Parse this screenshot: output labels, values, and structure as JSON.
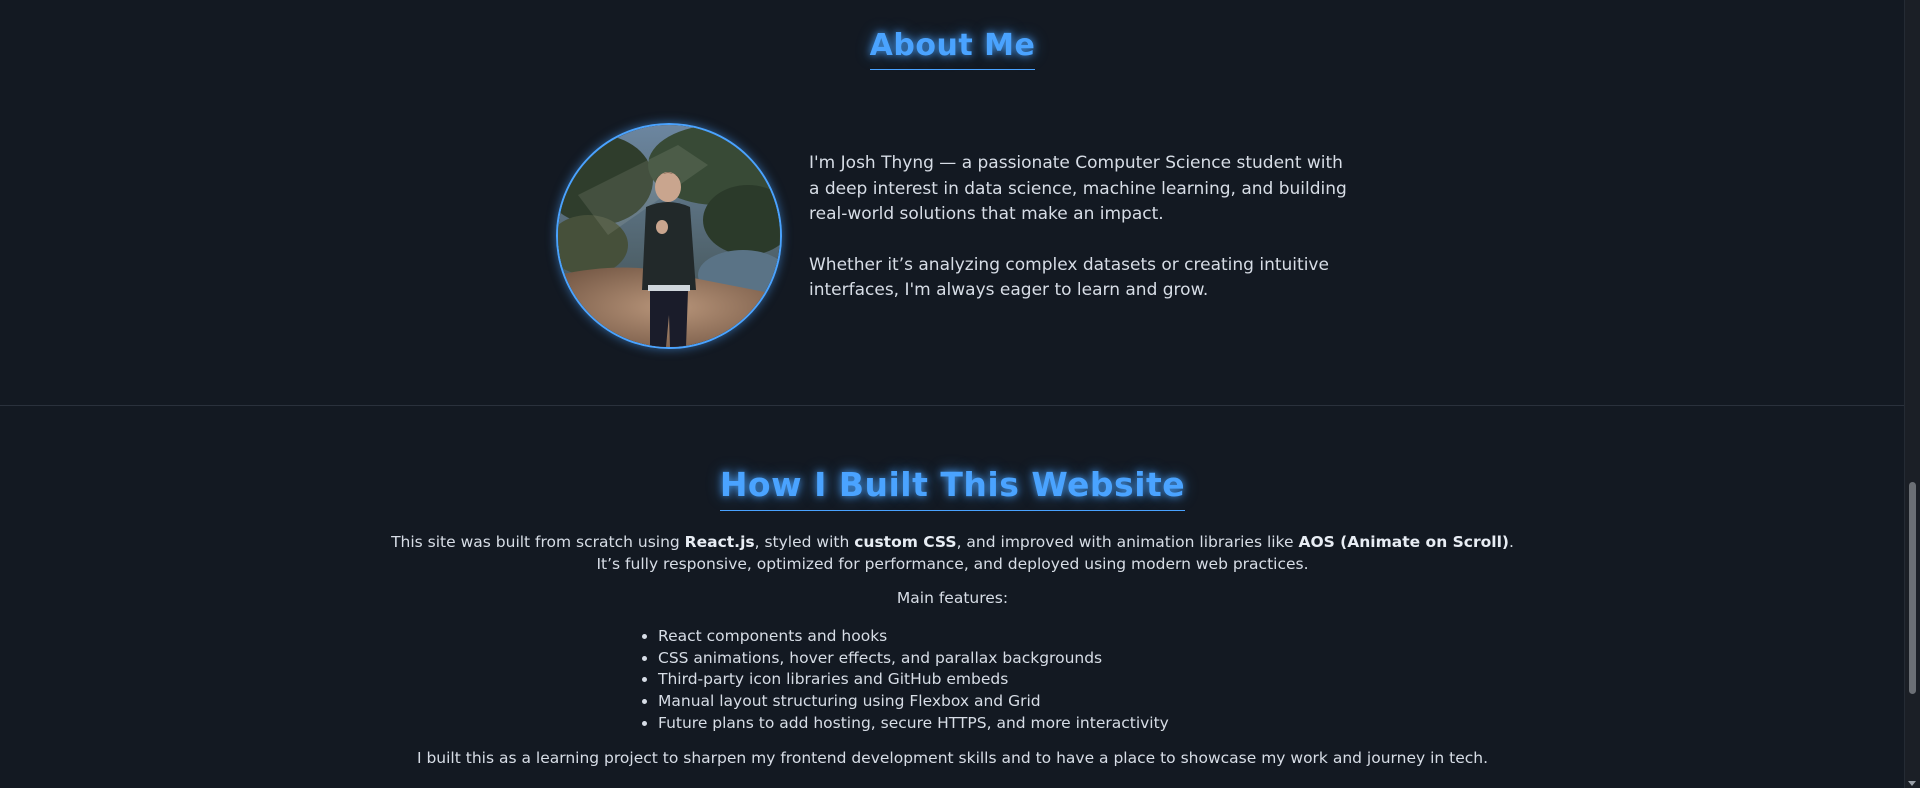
{
  "about": {
    "title": "About Me",
    "paragraph1": "I'm Josh Thyng — a passionate Computer Science student with a deep interest in data science, machine learning, and building real-world solutions that make an impact.",
    "paragraph2": "Whether it’s analyzing complex datasets or creating intuitive interfaces, I'm always eager to learn and grow."
  },
  "build": {
    "title": "How I Built This Website",
    "intro": {
      "part1": "This site was built from scratch using ",
      "react": "React.js",
      "part2": ", styled with ",
      "css": "custom CSS",
      "part3": ", and improved with animation libraries like ",
      "aos": "AOS (Animate on Scroll)",
      "part4": ".",
      "line2": "It’s fully responsive, optimized for performance, and deployed using modern web practices."
    },
    "features_label": "Main features:",
    "features": [
      "React components and hooks",
      "CSS animations, hover effects, and parallax backgrounds",
      "Third-party icon libraries and GitHub embeds",
      "Manual layout structuring using Flexbox and Grid",
      "Future plans to add hosting, secure HTTPS, and more interactivity"
    ],
    "outro": "I built this as a learning project to sharpen my frontend development skills and to have a place to showcase my work and journey in tech."
  },
  "colors": {
    "background": "#131922",
    "accent": "#4aa3ff",
    "text": "#d7dde6"
  }
}
